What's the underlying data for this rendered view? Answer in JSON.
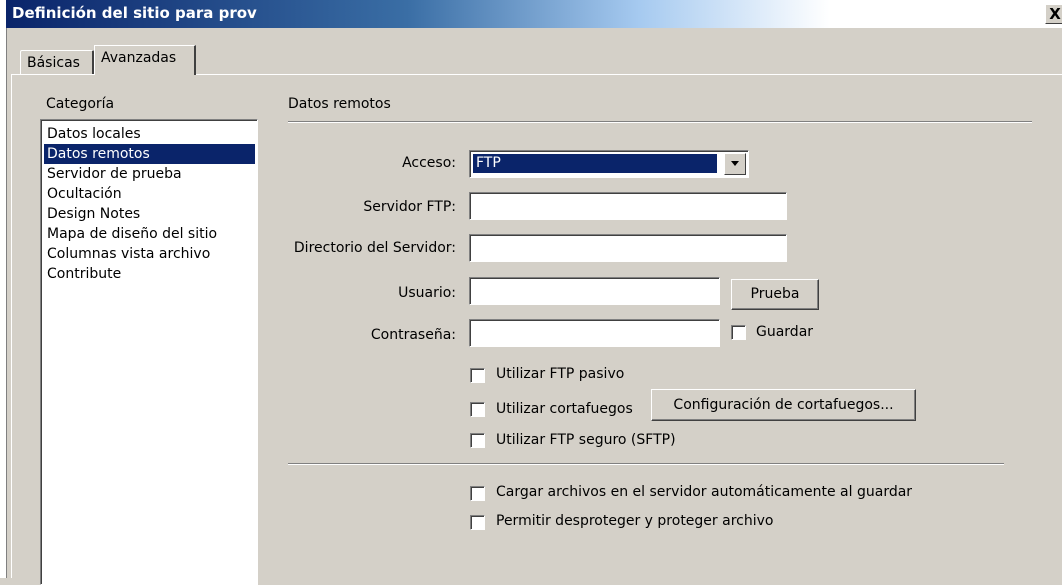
{
  "window": {
    "title": "Definición del sitio para prov",
    "close_glyph": "X"
  },
  "tabs": [
    {
      "label": "Básicas",
      "active": false
    },
    {
      "label": "Avanzadas",
      "active": true
    }
  ],
  "category": {
    "label": "Categoría",
    "items": [
      {
        "label": "Datos locales",
        "selected": false
      },
      {
        "label": "Datos remotos",
        "selected": true
      },
      {
        "label": "Servidor de prueba",
        "selected": false
      },
      {
        "label": "Ocultación",
        "selected": false
      },
      {
        "label": "Design Notes",
        "selected": false
      },
      {
        "label": "Mapa de diseño del sitio",
        "selected": false
      },
      {
        "label": "Columnas vista archivo",
        "selected": false
      },
      {
        "label": "Contribute",
        "selected": false
      }
    ]
  },
  "section": {
    "title": "Datos remotos"
  },
  "form": {
    "acceso": {
      "label": "Acceso:",
      "value": "FTP"
    },
    "servidor_ftp": {
      "label": "Servidor FTP:",
      "value": ""
    },
    "directorio": {
      "label": "Directorio del Servidor:",
      "value": ""
    },
    "usuario": {
      "label": "Usuario:",
      "value": ""
    },
    "contrasena": {
      "label": "Contraseña:",
      "value": ""
    },
    "prueba_button": "Prueba",
    "guardar": {
      "label": "Guardar",
      "checked": false
    },
    "ftp_pasivo": {
      "label": "Utilizar FTP pasivo",
      "checked": false
    },
    "cortafuegos": {
      "label": "Utilizar cortafuegos",
      "checked": false
    },
    "config_cortafuegos_button": "Configuración de cortafuegos...",
    "ftp_seguro": {
      "label": "Utilizar FTP seguro (SFTP)",
      "checked": false
    },
    "cargar_auto": {
      "label": "Cargar archivos en el servidor automáticamente al guardar",
      "checked": false
    },
    "desproteger": {
      "label": "Permitir desproteger y proteger archivo",
      "checked": false
    }
  },
  "colors": {
    "selection": "#0a246a",
    "face": "#d4d0c8"
  }
}
